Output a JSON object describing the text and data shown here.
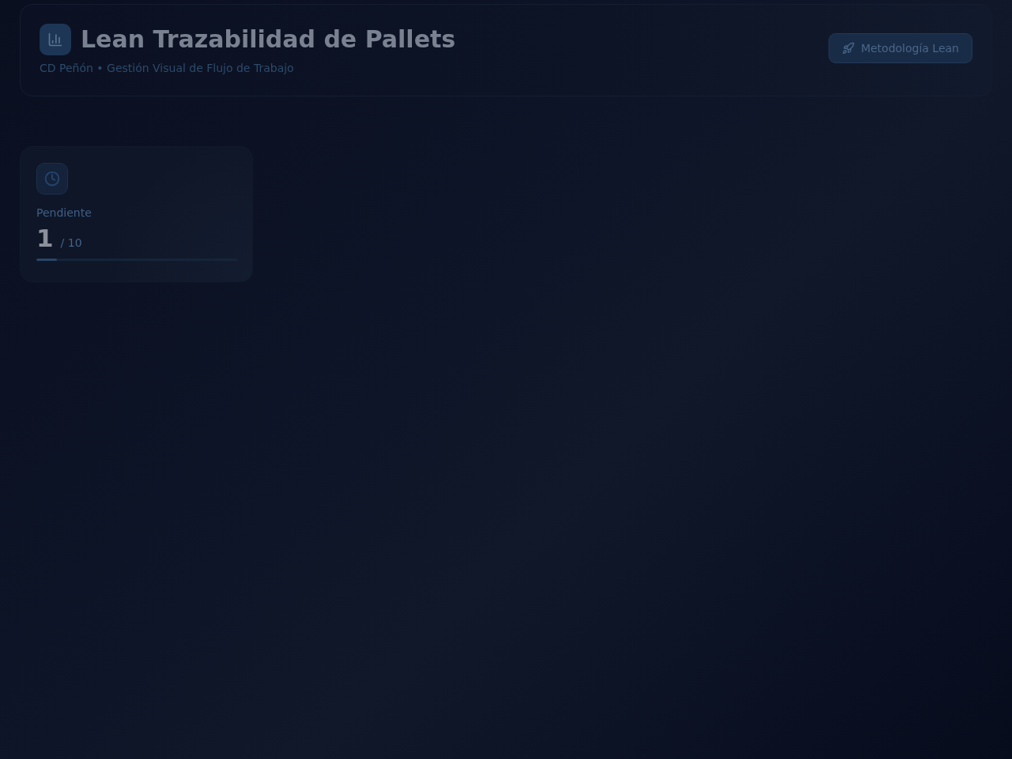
{
  "header": {
    "title": "Lean Trazabilidad de Pallets",
    "subtitle": "CD Peñón • Gestión Visual de Flujo de Trabajo",
    "button": {
      "label": "Metodología Lean"
    }
  },
  "stats": [
    {
      "label": "Pendiente",
      "value": "1",
      "total": "/ 10",
      "level": 0.1
    }
  ]
}
